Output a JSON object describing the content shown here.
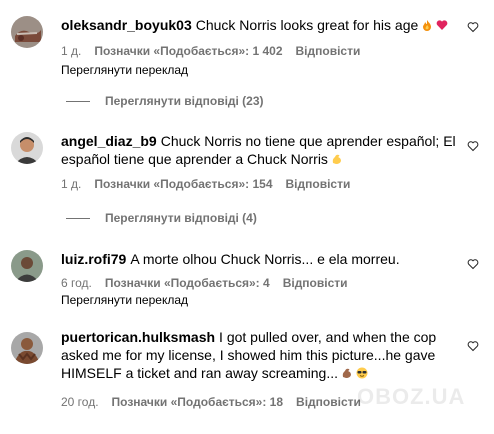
{
  "comments": [
    {
      "username": "oleksandr_boyuk03",
      "text": "Chuck Norris looks great for his age",
      "emojis": [
        "fire-emoji",
        "red-heart-emoji"
      ],
      "time": "1 д.",
      "likes": "Позначки «Подобається»: 1 402",
      "reply": "Відповісти",
      "translate": "Переглянути переклад",
      "view_replies": "Переглянути відповіді (23)"
    },
    {
      "username": "angel_diaz_b9",
      "text": "Chuck Norris no tiene que aprender español; El español tiene que aprender a Chuck Norris",
      "emojis": [
        "flexed-biceps-emoji"
      ],
      "time": "1 д.",
      "likes": "Позначки «Подобається»: 154",
      "reply": "Відповісти",
      "view_replies": "Переглянути відповіді (4)"
    },
    {
      "username": "luiz.rofi79",
      "text": "A morte olhou Chuck Norris... e ela morreu.",
      "time": "6 год.",
      "likes": "Позначки «Подобається»: 4",
      "reply": "Відповісти",
      "translate": "Переглянути переклад"
    },
    {
      "username": "puertorican.hulksmash",
      "text": "I got pulled over, and when the cop asked me for my license, I showed him this picture...he gave HIMSELF a ticket and ran away screaming...",
      "emojis": [
        "flexed-biceps-emoji",
        "sunglasses-face-emoji"
      ],
      "time": "20 год.",
      "likes": "Позначки «Подобається»: 18",
      "reply": "Відповісти"
    }
  ],
  "watermark": "OBOZ.UA",
  "colors": {
    "meta": "#737373",
    "text": "#000000",
    "background": "#ffffff"
  }
}
